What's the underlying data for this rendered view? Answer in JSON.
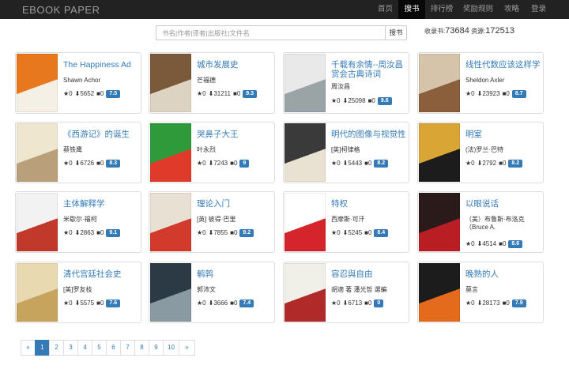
{
  "brand": "EBOOK   PAPER",
  "nav": [
    {
      "label": "首页",
      "active": false
    },
    {
      "label": "搜书",
      "active": true
    },
    {
      "label": "排行榜",
      "active": false
    },
    {
      "label": "奖励规则",
      "active": false
    },
    {
      "label": "攻略",
      "active": false
    },
    {
      "label": "登录",
      "active": false
    }
  ],
  "search": {
    "placeholder": "书名|作者|译者|出版社|文件名",
    "value": "",
    "button": "搜书"
  },
  "stats": {
    "books_label": "收录书:",
    "books": "73684",
    "res_label": "资源:",
    "res": "172513"
  },
  "books": [
    {
      "title": "The Happiness Ad",
      "author": "Shawn Achor",
      "stars": "0",
      "downloads": "5652",
      "comments": "0",
      "score": "7.5",
      "colors": [
        "#e8781e",
        "#f5f0e6"
      ]
    },
    {
      "title": "城市发展史",
      "author": "芒福德",
      "stars": "0",
      "downloads": "31211",
      "comments": "0",
      "score": "9.3",
      "colors": [
        "#7a5a3a",
        "#dcd3c3"
      ]
    },
    {
      "title": "千载有余情--周汝昌赏会古典诗词",
      "author": "周汝昌",
      "stars": "0",
      "downloads": "25098",
      "comments": "0",
      "score": "9.6",
      "colors": [
        "#e9e9e9",
        "#9aa4a6"
      ]
    },
    {
      "title": "线性代数应该这样学",
      "author": "Sheldon Axler",
      "stars": "0",
      "downloads": "23923",
      "comments": "0",
      "score": "8.7",
      "colors": [
        "#d6c4aa",
        "#8b5e3c"
      ]
    },
    {
      "title": "《西游记》的诞生",
      "author": "蔡铁鹰",
      "stars": "0",
      "downloads": "6726",
      "comments": "0",
      "score": "8.3",
      "colors": [
        "#efe6cf",
        "#b9a07a"
      ]
    },
    {
      "title": "哭鼻子大王",
      "author": "叶永烈",
      "stars": "0",
      "downloads": "7243",
      "comments": "0",
      "score": "9",
      "colors": [
        "#2f9a3a",
        "#e03a2a"
      ]
    },
    {
      "title": "明代的图像与视觉性",
      "author": "[英]柯律格",
      "stars": "0",
      "downloads": "5443",
      "comments": "0",
      "score": "8.2",
      "colors": [
        "#3a3a3a",
        "#e9e2d2"
      ]
    },
    {
      "title": "明室",
      "author": "(法)罗兰·巴特",
      "stars": "0",
      "downloads": "2792",
      "comments": "0",
      "score": "8.2",
      "colors": [
        "#d9a534",
        "#1c1c1c"
      ]
    },
    {
      "title": "主体解释学",
      "author": "米歇尔·福柯",
      "stars": "0",
      "downloads": "2863",
      "comments": "0",
      "score": "9.1",
      "colors": [
        "#f2f2f2",
        "#c0392b"
      ]
    },
    {
      "title": "理论入门",
      "author": "[英] 彼得·巴里",
      "stars": "0",
      "downloads": "7855",
      "comments": "0",
      "score": "9.2",
      "colors": [
        "#e8e1d3",
        "#d23a2c"
      ]
    },
    {
      "title": "特权",
      "author": "西摩斯·可汗",
      "stars": "0",
      "downloads": "5245",
      "comments": "0",
      "score": "8.4",
      "colors": [
        "#ffffff",
        "#d4242c"
      ]
    },
    {
      "title": "以眼说话",
      "author": "（美）布鲁斯·布洛克（Bruce A.",
      "stars": "0",
      "downloads": "4514",
      "comments": "0",
      "score": "8.6",
      "colors": [
        "#2a1a1a",
        "#b81e24"
      ]
    },
    {
      "title": "清代宫廷社会史",
      "author": "[美]罗友枝",
      "stars": "0",
      "downloads": "5575",
      "comments": "0",
      "score": "7.6",
      "colors": [
        "#e9d9b0",
        "#c7a45e"
      ]
    },
    {
      "title": "鹌鹑",
      "author": "郭沛文",
      "stars": "0",
      "downloads": "3666",
      "comments": "0",
      "score": "7.4",
      "colors": [
        "#2b3a44",
        "#8a9aa2"
      ]
    },
    {
      "title": "容忍與自由",
      "author": "胡適 著 潘光哲 選編",
      "stars": "0",
      "downloads": "6713",
      "comments": "0",
      "score": "0",
      "colors": [
        "#f0efe8",
        "#b02a2a"
      ]
    },
    {
      "title": "晚熟的人",
      "author": "莫言",
      "stars": "0",
      "downloads": "28173",
      "comments": "0",
      "score": "7.9",
      "colors": [
        "#1c1c1c",
        "#e46a1c"
      ]
    }
  ],
  "pagination": {
    "prev": "«",
    "pages": [
      "1",
      "2",
      "3",
      "4",
      "5",
      "6",
      "7",
      "8",
      "9",
      "10"
    ],
    "next": "»",
    "active": "1"
  }
}
